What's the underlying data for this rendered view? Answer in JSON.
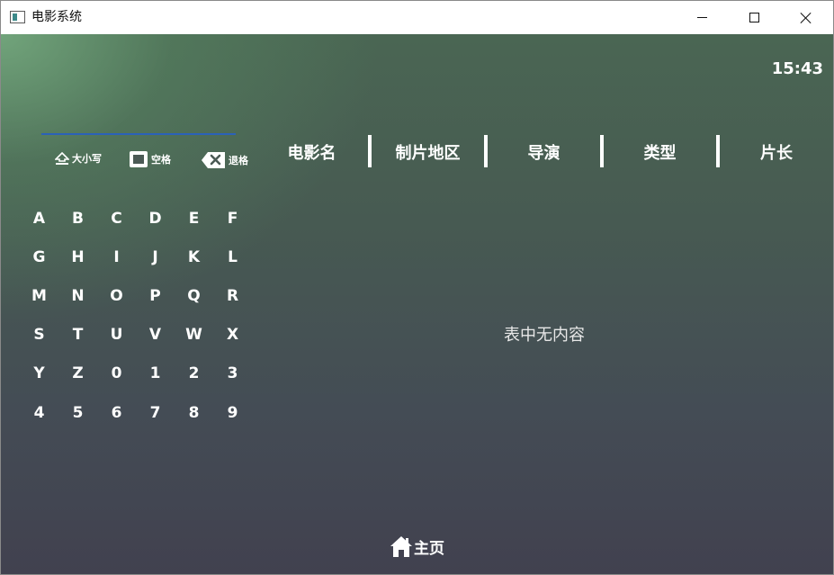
{
  "window": {
    "title": "电影系统"
  },
  "clock": "15:43",
  "keyboard": {
    "caps_label": "大小写",
    "space_label": "空格",
    "backspace_label": "退格",
    "keys": [
      "A",
      "B",
      "C",
      "D",
      "E",
      "F",
      "G",
      "H",
      "I",
      "J",
      "K",
      "L",
      "M",
      "N",
      "O",
      "P",
      "Q",
      "R",
      "S",
      "T",
      "U",
      "V",
      "W",
      "X",
      "Y",
      "Z",
      "0",
      "1",
      "2",
      "3",
      "4",
      "5",
      "6",
      "7",
      "8",
      "9"
    ]
  },
  "table": {
    "columns": [
      "电影名",
      "制片地区",
      "导演",
      "类型",
      "片长"
    ],
    "empty_message": "表中无内容"
  },
  "footer": {
    "home_label": "主页"
  }
}
